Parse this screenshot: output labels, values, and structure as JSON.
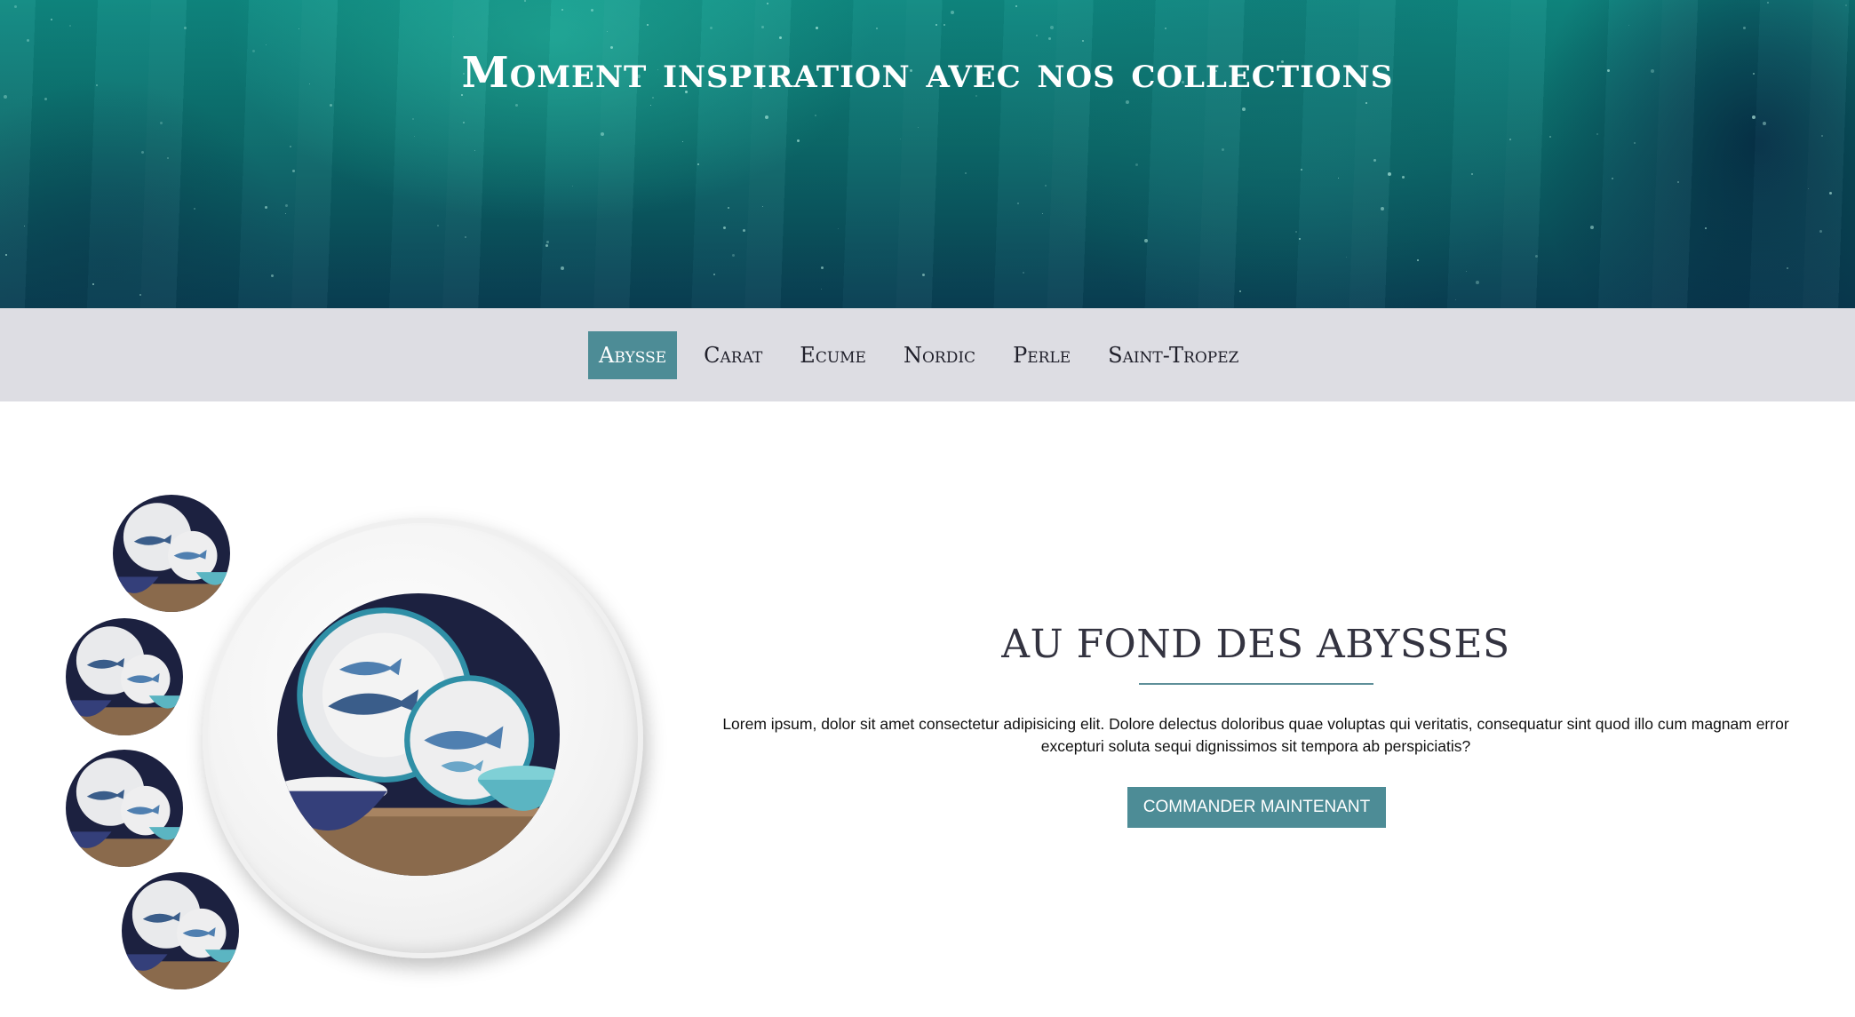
{
  "hero": {
    "title": "Moment inspiration avec nos collections"
  },
  "nav": {
    "items": [
      {
        "label": "Abysse",
        "active": true
      },
      {
        "label": "Carat",
        "active": false
      },
      {
        "label": "Ecume",
        "active": false
      },
      {
        "label": "Nordic",
        "active": false
      },
      {
        "label": "Perle",
        "active": false
      },
      {
        "label": "Saint-Tropez",
        "active": false
      }
    ]
  },
  "collection": {
    "title": "AU FOND DES ABYSSES",
    "description": "Lorem ipsum, dolor sit amet consectetur adipisicing elit. Dolore delectus doloribus quae voluptas qui veritatis, consequatur sint quod illo cum magnam error excepturi soluta sequi dignissimos sit tempora ab perspiciatis?",
    "cta_label": "Commander maintenant"
  },
  "colors": {
    "accent": "#4d8c96",
    "nav_bg": "#dddde3",
    "hero_teal": "#0f8a82"
  }
}
